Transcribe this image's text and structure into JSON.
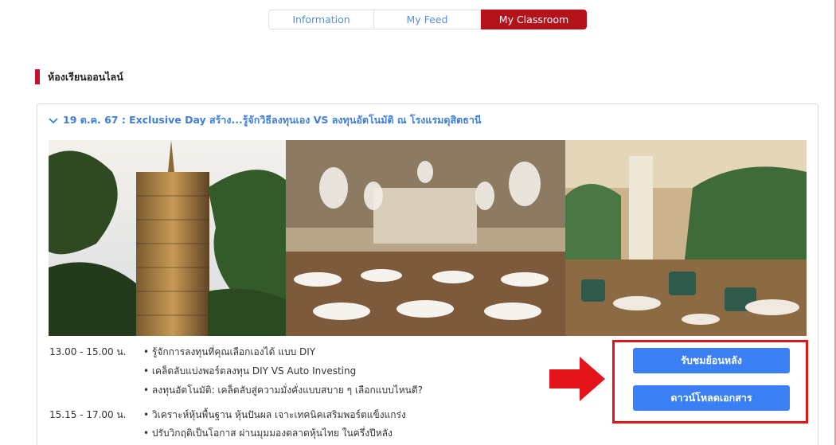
{
  "tabs": [
    {
      "label": "Information"
    },
    {
      "label": "My Feed"
    },
    {
      "label": "My Classroom",
      "active": true
    }
  ],
  "section": {
    "title": "ห้องเรียนออนไลน์"
  },
  "course": {
    "title": "19 ต.ค. 67 : Exclusive Day สร้าง...รู้จักวิธีลงทุนเอง VS ลงทุนอัตโนมัติ ณ โรงแรมดุสิตธานี",
    "schedule": [
      {
        "time": "13.00 - 15.00 น.",
        "items": [
          "• รู้จักการลงทุนที่คุณเลือกเองได้ แบบ DIY",
          "• เคล็ดลับแบ่งพอร์ตลงทุน DIY VS Auto Investing",
          "• ลงทุนอัตโนมัติ: เคล็ดลับสู่ความมั่งคั่งแบบสบาย ๆ เลือกแบบไหนดี?"
        ]
      },
      {
        "time": "15.15 - 17.00 น.",
        "items": [
          "• วิเคราะห์หุ้นพื้นฐาน หุ้นปันผล เจาะเทคนิคเสริมพอร์ตแข็งแกร่ง",
          "• ปรับวิกฤติเป็นโอกาส ผ่านมุมมองตลาดหุ้นไทย ในครึ่งปีหลัง"
        ]
      }
    ],
    "buttons": {
      "watch": "รับชมย้อนหลัง",
      "download": "ดาวน์โหลดเอกสาร"
    }
  },
  "colors": {
    "accent": "#b5121b",
    "link": "#3d7fd9",
    "button": "#3b7ff5",
    "highlight": "#e3151a"
  },
  "icons": {
    "expand": "chevron-down-icon",
    "pointer": "right-arrow-icon"
  }
}
